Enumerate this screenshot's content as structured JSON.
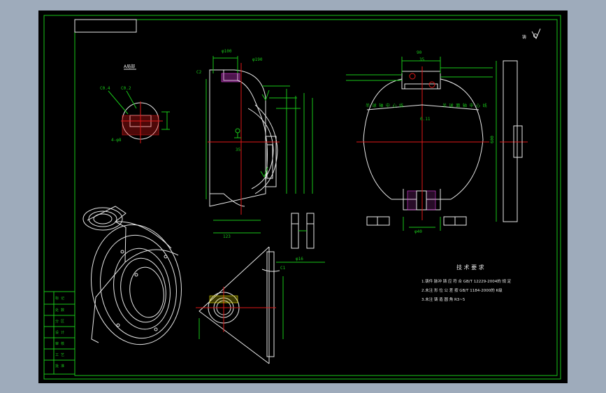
{
  "colors": {
    "background": "#000000",
    "frame": "#9eabbb",
    "line": "#19c619",
    "outline": "#e8e8e8",
    "centerline": "#e01818",
    "dimension": "#00d8d8",
    "hatch": "#e040e0"
  },
  "tech_requirements": {
    "title": "技 术 要 求",
    "items": [
      "1.铸件 脉冲 铸 应 符 合 GB/T 12229-2004的 规 定",
      "2.未注 形 位 公 差 按 GB/T 1184-2000的 K级",
      "3.未注 铸 造 圆 角 R3~5"
    ]
  },
  "labels": {
    "semi_center_left": "半 球 轴 中 心 线",
    "semi_center_right": "半 球 面 轴 中 心 线",
    "view_label": "A局部",
    "symbol": "铸",
    "c1": "C1",
    "c2": "C2"
  },
  "dimensions": {
    "d1": "φ100",
    "d2": "φ190",
    "d3": "90",
    "d4": "35",
    "d5": "600",
    "d6": "123",
    "d7": "φ40",
    "d8": "C0.4",
    "d9": "C0.2",
    "d10": "4-φ8",
    "d11": "0.11",
    "d12": "φ16",
    "d13": "650",
    "d14": "φ400"
  },
  "title_block": {
    "rows": [
      "标 记",
      "处 数",
      "分 区",
      "设 计",
      "审 核",
      "工 艺",
      "批 准"
    ]
  }
}
